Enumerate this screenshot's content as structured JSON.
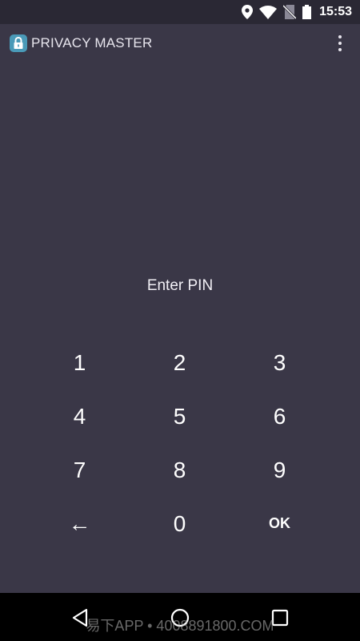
{
  "status_bar": {
    "time": "15:53",
    "icons": [
      "location-icon",
      "wifi-icon",
      "no-sim-icon",
      "battery-icon"
    ]
  },
  "app_bar": {
    "title": "PRIVACY MASTER",
    "app_icon": "lock-icon",
    "menu_icon": "overflow-menu-icon"
  },
  "prompt": {
    "text": "Enter PIN"
  },
  "keypad": {
    "keys": [
      "1",
      "2",
      "3",
      "4",
      "5",
      "6",
      "7",
      "8",
      "9",
      "←",
      "0",
      "OK"
    ]
  },
  "nav_bar": {
    "icons": [
      "back-icon",
      "home-icon",
      "recents-icon"
    ]
  },
  "watermark": {
    "text": "易下APP • 4008891800.COM"
  },
  "colors": {
    "background": "#3a3747",
    "status_bar": "#2a2834",
    "nav_bar": "#000000",
    "app_icon_bg": "#4a9ab8"
  }
}
